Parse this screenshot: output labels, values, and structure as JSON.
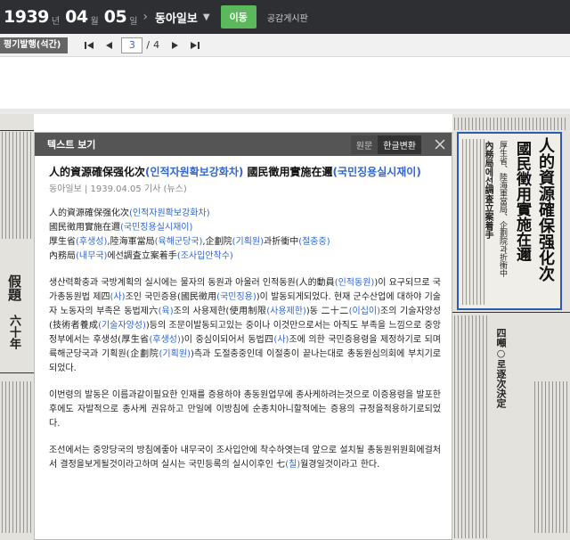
{
  "topbar": {
    "year": "1939",
    "year_unit": "년",
    "month": "04",
    "month_unit": "월",
    "day": "05",
    "day_unit": "일",
    "newspaper": "동아일보",
    "move_label": "이동",
    "board_label": "공감게시판"
  },
  "toolbar": {
    "edition_label": "평기발행(석간)",
    "page_current": "3",
    "page_separator": "/",
    "page_total": "4"
  },
  "viewer": {
    "title": "텍스트 보기",
    "original_label": "원문",
    "hangul_label": "한글변환",
    "article": {
      "title_a": "人的資源確保强化次",
      "title_a_ko": "(인적자원확보강화차)",
      "title_b": " 國民徵用實施在邇",
      "title_b_ko": "(국민징용실시재이)",
      "meta": "동아일보 | 1939.04.05 기사 (뉴스)",
      "subs": [
        {
          "t1": "人的資源確保强化次",
          "k1": "(인적자원확보강화차)"
        },
        {
          "t1": "國民徵用實施在邇",
          "k1": "(국민징용실시재이)"
        },
        {
          "t1": "厚生省",
          "k1": "(후생성)",
          "t2": ",陸海軍當局",
          "k2": "(육해군당국)",
          "t3": ",企劃院",
          "k3": "(기획원)",
          "t4": "과折衝中",
          "k4": "(절충중)"
        },
        {
          "t1": "內務局",
          "k1": "(내무국)",
          "t2": "에선調査立案着手",
          "k2": "(조사입안착수)"
        }
      ],
      "para1": [
        {
          "t": "생산력확충과 국방계획의 실시에는 물자의 동원과 아울러 인적동원(人的動員"
        },
        {
          "k": "(인적동원)"
        },
        {
          "t": ")이 요구되므로 국가총동원법 제四"
        },
        {
          "k": "(사)"
        },
        {
          "t": "조인 국민증용(國民徵用"
        },
        {
          "k": "(국민징용)"
        },
        {
          "t": ")이 발동되게되었다. 현재 군수산업에 대하야 기술자 노동자의 부족은 동법제六"
        },
        {
          "k": "(육)"
        },
        {
          "t": "조의 사용제한(使用制限"
        },
        {
          "k": "(사용제한)"
        },
        {
          "t": ")동 二十二"
        },
        {
          "k": "(이십이)"
        },
        {
          "t": "조의 기술자양성(技術者養成"
        },
        {
          "k": "(기술자양성)"
        },
        {
          "t": ")등의 조문이발동되고있는 중이나 이것만으로서는 아직도 부족을 느낌으로 중앙정부에서는 후생성(厚生省"
        },
        {
          "k": "(후생성)"
        },
        {
          "t": ")이 중심이되어서 동법四"
        },
        {
          "k": "(사)"
        },
        {
          "t": "조에 의한 국민증용령을 제정하기로 되며 륙해군당국과 기획원(企劃院"
        },
        {
          "k": "(기획원)"
        },
        {
          "t": ")측과 도절충중인데 이절충이 끝나는대로 총동원심의회에 부치기로 되었다."
        }
      ],
      "para2": "이번령의 발동은 이름과같이필요한 인재를 증용하야 총동원업무에 종사케하려는것으로 이증용령을 발포한후에도 자발적으로 종사케 권유하고 만일에 이방침에 순종치아니할적에는 증용의 규정을적용하기로되었다.",
      "para3": [
        {
          "t": "조선에서는 중앙당국의 방침에좋아 내무국이 조사입안에 착수하엿는데 앞으로 설치될 총동원위원회에걸처서 결정을보게될것이라고하며 실시는 국민등록의 실시이후인 七"
        },
        {
          "k": "(칠)"
        },
        {
          "t": "월경일것이라고 한다."
        }
      ]
    }
  },
  "newspaper_scan": {
    "headline_main": "人的資源確保强化次",
    "headline_sub": "國民徵用實施在邇",
    "headline_side": "厚生省、陸海軍當局、企劃院과折衝中",
    "headline_side2": "內務局에선調査立案着手",
    "right_lower": "四噸○로逐次決定",
    "left_upper": "假題",
    "left_lower": "六十年"
  },
  "colors": {
    "topbar_bg": "#2e2f33",
    "move_button": "#5cb85c",
    "hangul_link": "#3366cc",
    "modal_header": "#555555",
    "headline_frame": "#2a5db0"
  }
}
